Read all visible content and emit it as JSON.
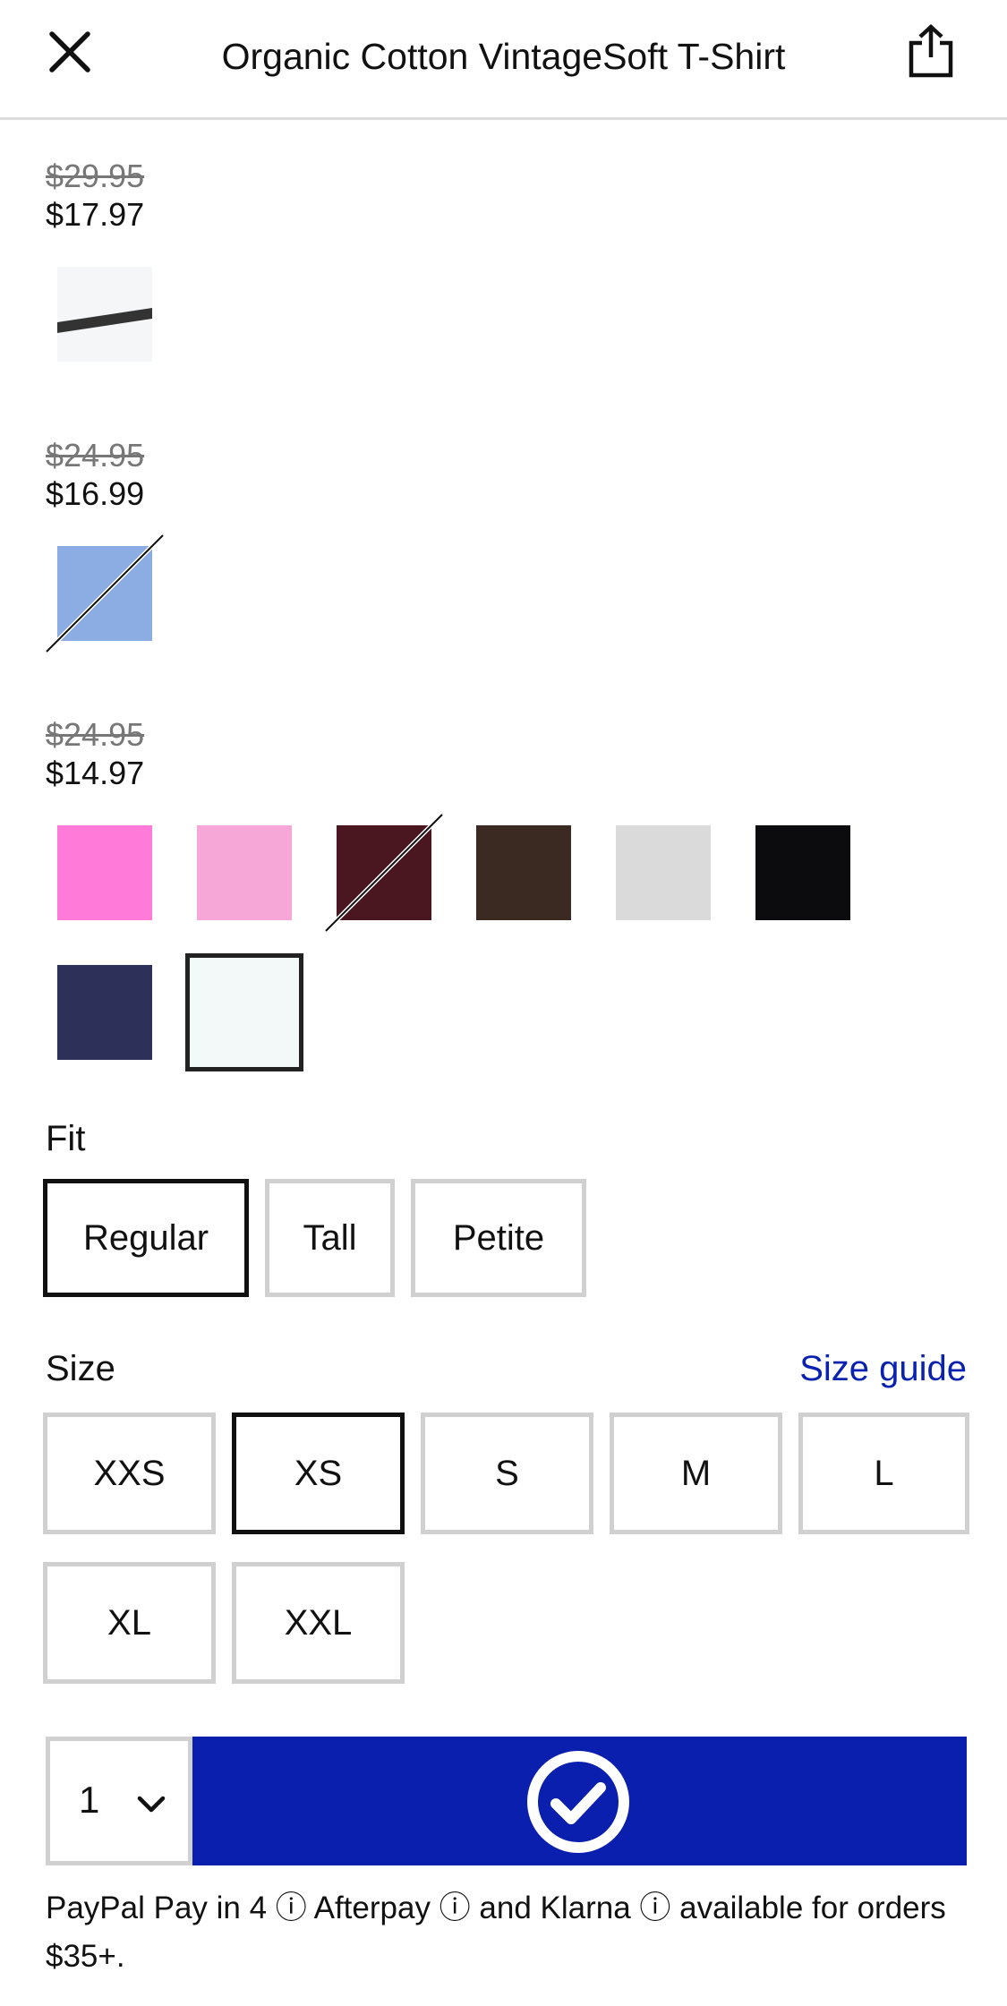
{
  "header": {
    "title": "Organic Cotton VintageSoft T-Shirt",
    "close_icon": "close-icon",
    "share_icon": "share-icon"
  },
  "price_groups": [
    {
      "original_price": "$29.95",
      "sale_price": "$17.97",
      "swatches": [
        {
          "name": "white-with-black-stripe",
          "color": "#f4f6f8",
          "stripe": "#333333",
          "unavailable": false
        }
      ]
    },
    {
      "original_price": "$24.95",
      "sale_price": "$16.99",
      "swatches": [
        {
          "name": "light-blue",
          "color": "#8cace4",
          "unavailable": true
        }
      ]
    },
    {
      "original_price": "$24.95",
      "sale_price": "$14.97",
      "swatches": [
        {
          "name": "hot-pink",
          "color": "#ff7ad9",
          "unavailable": false
        },
        {
          "name": "light-pink",
          "color": "#f7a6d8",
          "unavailable": false
        },
        {
          "name": "burgundy",
          "color": "#4a1620",
          "unavailable": true
        },
        {
          "name": "dark-brown",
          "color": "#3b2a21",
          "unavailable": false
        },
        {
          "name": "light-heather-gray",
          "color": "#dadada",
          "unavailable": false
        },
        {
          "name": "black",
          "color": "#0c0c0e",
          "unavailable": false
        },
        {
          "name": "navy",
          "color": "#2d3058",
          "unavailable": false
        },
        {
          "name": "white",
          "color": "#f3f8f8",
          "unavailable": false,
          "selected": true
        }
      ]
    }
  ],
  "fit": {
    "label": "Fit",
    "options": [
      "Regular",
      "Tall",
      "Petite"
    ],
    "selected": "Regular"
  },
  "size": {
    "label": "Size",
    "guide_link": "Size guide",
    "options": [
      "XXS",
      "XS",
      "S",
      "M",
      "L",
      "XL",
      "XXL"
    ],
    "selected": "XS"
  },
  "purchase": {
    "quantity": "1",
    "chevron_icon": "chevron-down-icon",
    "add_icon": "check-circle-icon",
    "button_color": "#0a1fae"
  },
  "payment_note": "PayPal Pay in 4 ⓘ Afterpay ⓘ and Klarna ⓘ available for orders $35+."
}
